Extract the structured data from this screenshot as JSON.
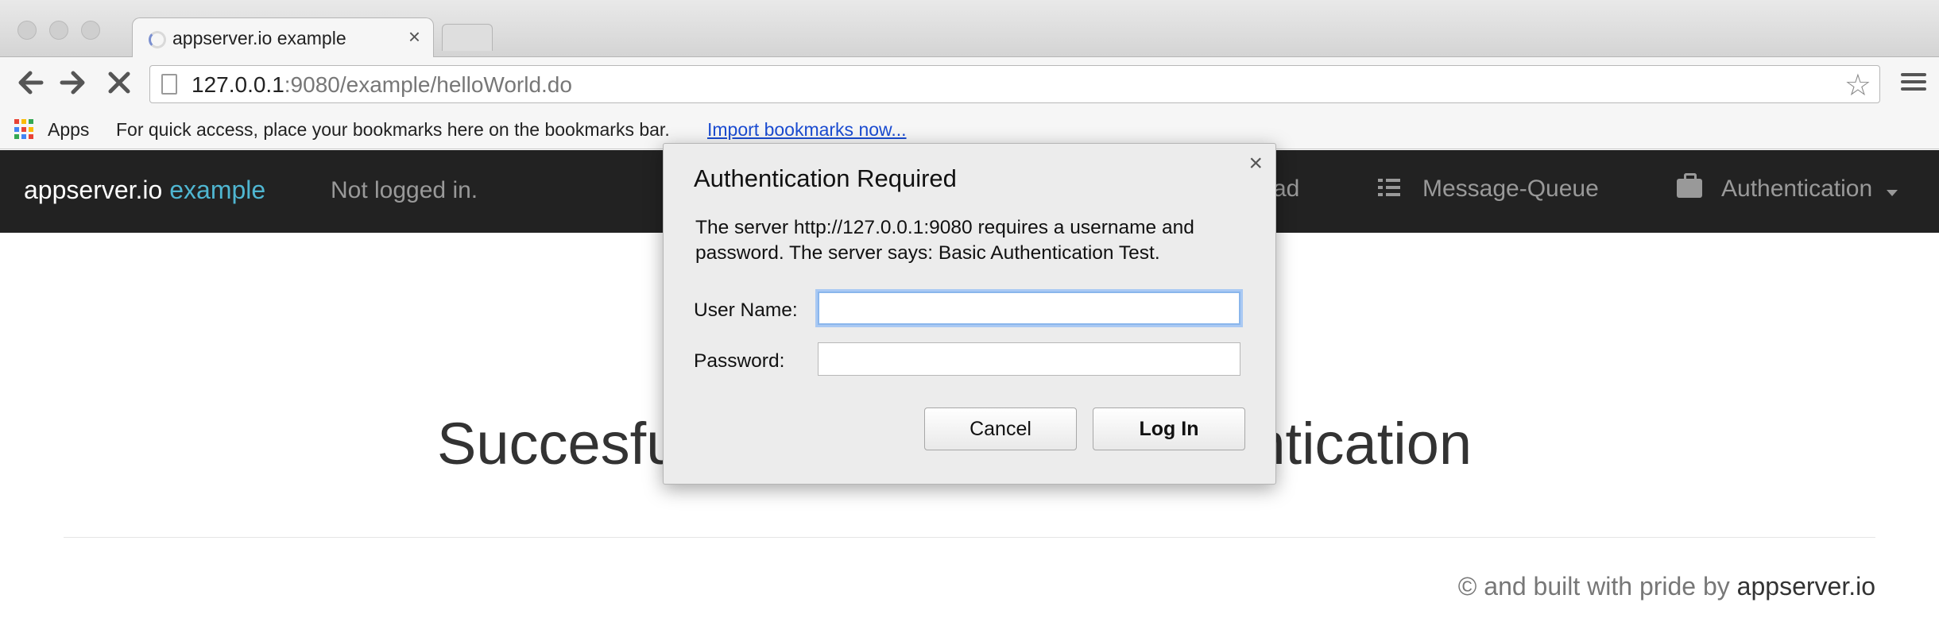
{
  "browser": {
    "tab": {
      "title": "appserver.io example",
      "close_glyph": "×"
    },
    "address": {
      "host": "127.0.0.1",
      "rest": ":9080/example/helloWorld.do"
    },
    "bookmarks_bar": {
      "apps_label": "Apps",
      "hint": "For quick access, place your bookmarks here on the bookmarks bar.",
      "import_link": "Import bookmarks now..."
    },
    "icons": [
      "back-icon",
      "forward-icon",
      "stop-icon",
      "page-icon",
      "star-icon",
      "menu-icon",
      "apps-icon"
    ]
  },
  "navbar": {
    "brand_main": "appserver.io",
    "brand_accent": "example",
    "status": "Not logged in.",
    "partial_item": "ad",
    "message_queue": "Message-Queue",
    "authentication": "Authentication",
    "brand_accent_color": "#4fb6d1",
    "background_color": "#222222"
  },
  "content": {
    "headline_left": "Succesfu",
    "headline_right": "ntication",
    "footer_prefix": "© and built with pride by",
    "footer_brand": "appserver.io"
  },
  "dialog": {
    "title": "Authentication Required",
    "message": "The server http://127.0.0.1:9080 requires a username and password. The server says: Basic Authentication Test.",
    "username_label": "User Name:",
    "username_value": "",
    "password_label": "Password:",
    "password_value": "",
    "cancel_label": "Cancel",
    "login_label": "Log In",
    "close_glyph": "×"
  }
}
